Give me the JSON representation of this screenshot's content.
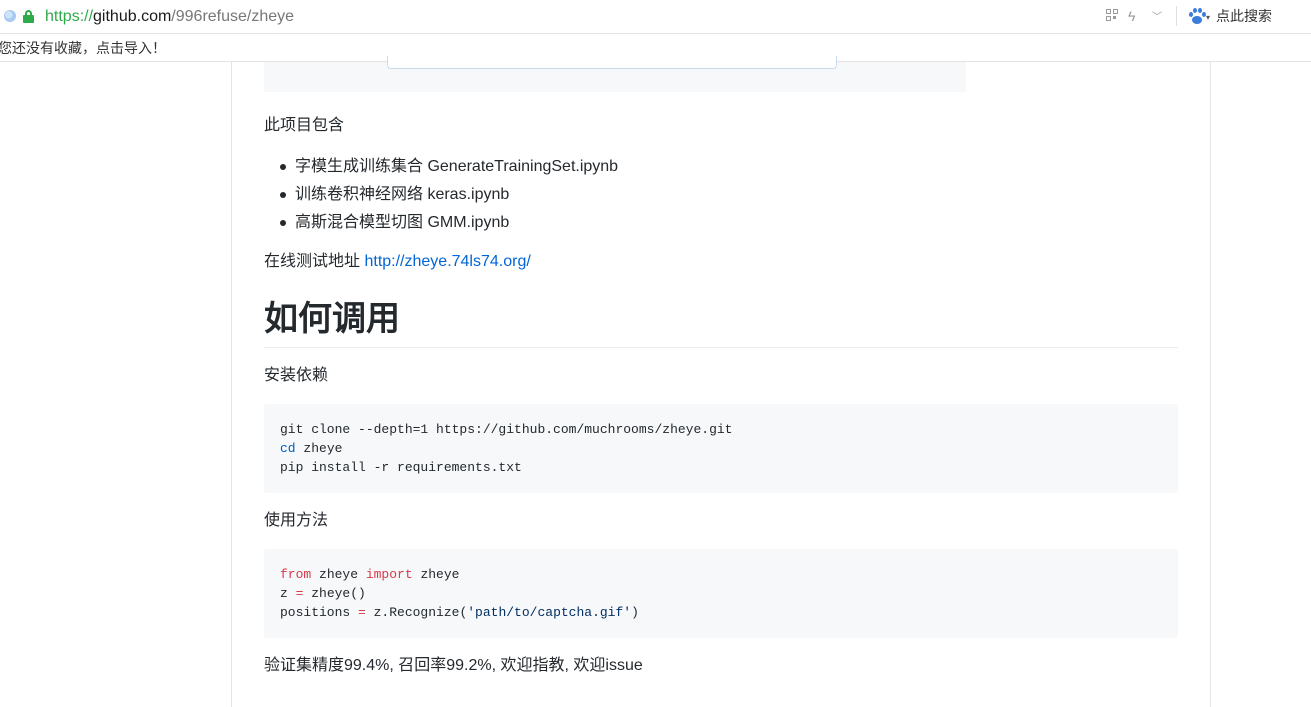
{
  "browser": {
    "url_scheme": "https://",
    "url_host": "github.com",
    "url_path": "/996refuse/zheye",
    "search_label": "点此搜索",
    "bookmark_notice": "您还没有收藏，点击导入！"
  },
  "readme": {
    "contains_label": "此项目包含",
    "items": [
      "字模生成训练集合 GenerateTrainingSet.ipynb",
      "训练卷积神经网络 keras.ipynb",
      "高斯混合模型切图 GMM.ipynb"
    ],
    "online_test_label": "在线测试地址",
    "online_test_url": "http://zheye.74ls74.org/",
    "heading": "如何调用",
    "install_label": "安装依赖",
    "install_code": {
      "line1": "git clone --depth=1 https://github.com/muchrooms/zheye.git",
      "line2_kw": "cd",
      "line2_rest": " zheye",
      "line3": "pip install -r requirements.txt"
    },
    "usage_label": "使用方法",
    "usage_code": {
      "l1_from": "from",
      "l1_mod": " zheye ",
      "l1_import": "import",
      "l1_name": " zheye",
      "l2_var": "z ",
      "l2_op": "=",
      "l2_call": " zheye()",
      "l3_var": "positions ",
      "l3_op": "=",
      "l3_call": " z.Recognize(",
      "l3_str": "'path/to/captcha.gif'",
      "l3_end": ")"
    },
    "stats": "验证集精度99.4%, 召回率99.2%, 欢迎指教, 欢迎issue"
  },
  "colors": {
    "link": "#0366d6",
    "secure_green": "#2eaa4b",
    "code_bg": "#f6f8fa",
    "keyword": "#d73a49"
  }
}
